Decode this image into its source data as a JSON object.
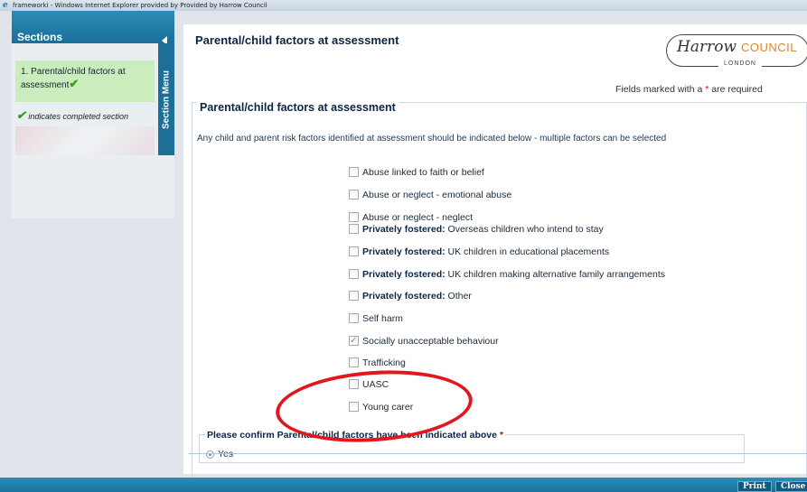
{
  "window": {
    "title": "frameworki - Windows Internet Explorer provided by Provided by Harrow Council"
  },
  "sidebar": {
    "title": "Sections",
    "tab_label": "Section Menu",
    "items": [
      {
        "label": "1. Parental/child factors at assessment",
        "completed": true
      }
    ],
    "legend_text": "indicates completed section"
  },
  "header": {
    "title": "Parental/child factors at assessment",
    "logo": {
      "script": "Harrow",
      "word": "COUNCIL",
      "sub": "LONDON"
    },
    "required_note_prefix": "Fields marked with a",
    "required_note_asterisk": "*",
    "required_note_suffix": "are required"
  },
  "form": {
    "legend": "Parental/child factors at assessment",
    "intro": "Any child and parent risk factors identified at assessment should be indicated below - multiple factors can be selected",
    "options": [
      {
        "prefix": "",
        "label": "Abuse linked to faith or belief",
        "checked": false
      },
      {
        "prefix": "",
        "label": "Abuse or neglect - emotional abuse",
        "checked": false
      },
      {
        "prefix": "",
        "label": "Abuse or neglect - neglect",
        "checked": false
      },
      {
        "prefix": "Privately fostered:",
        "label": "Overseas children who intend to stay",
        "checked": false
      },
      {
        "prefix": "Privately fostered:",
        "label": "UK children in educational placements",
        "checked": false
      },
      {
        "prefix": "Privately fostered:",
        "label": "UK children making alternative family arrangements",
        "checked": false
      },
      {
        "prefix": "Privately fostered:",
        "label": "Other",
        "checked": false
      },
      {
        "prefix": "",
        "label": "Self harm",
        "checked": false
      },
      {
        "prefix": "",
        "label": "Socially unacceptable behaviour",
        "checked": true
      },
      {
        "prefix": "",
        "label": "Trafficking",
        "checked": false
      },
      {
        "prefix": "",
        "label": "UASC",
        "checked": false
      },
      {
        "prefix": "",
        "label": "Young carer",
        "checked": false
      }
    ],
    "confirm": {
      "legend": "Please confirm Parental/child factors have been indicated above",
      "asterisk": "*",
      "radio_label": "Yes",
      "selected": true
    }
  },
  "footer": {
    "print_label": "Print",
    "close_label": "Close"
  },
  "colors": {
    "header_blue": "#1a6f98",
    "completed_green": "#c9edbd",
    "highlight_red": "#e2171d",
    "council_orange": "#e0842b"
  }
}
